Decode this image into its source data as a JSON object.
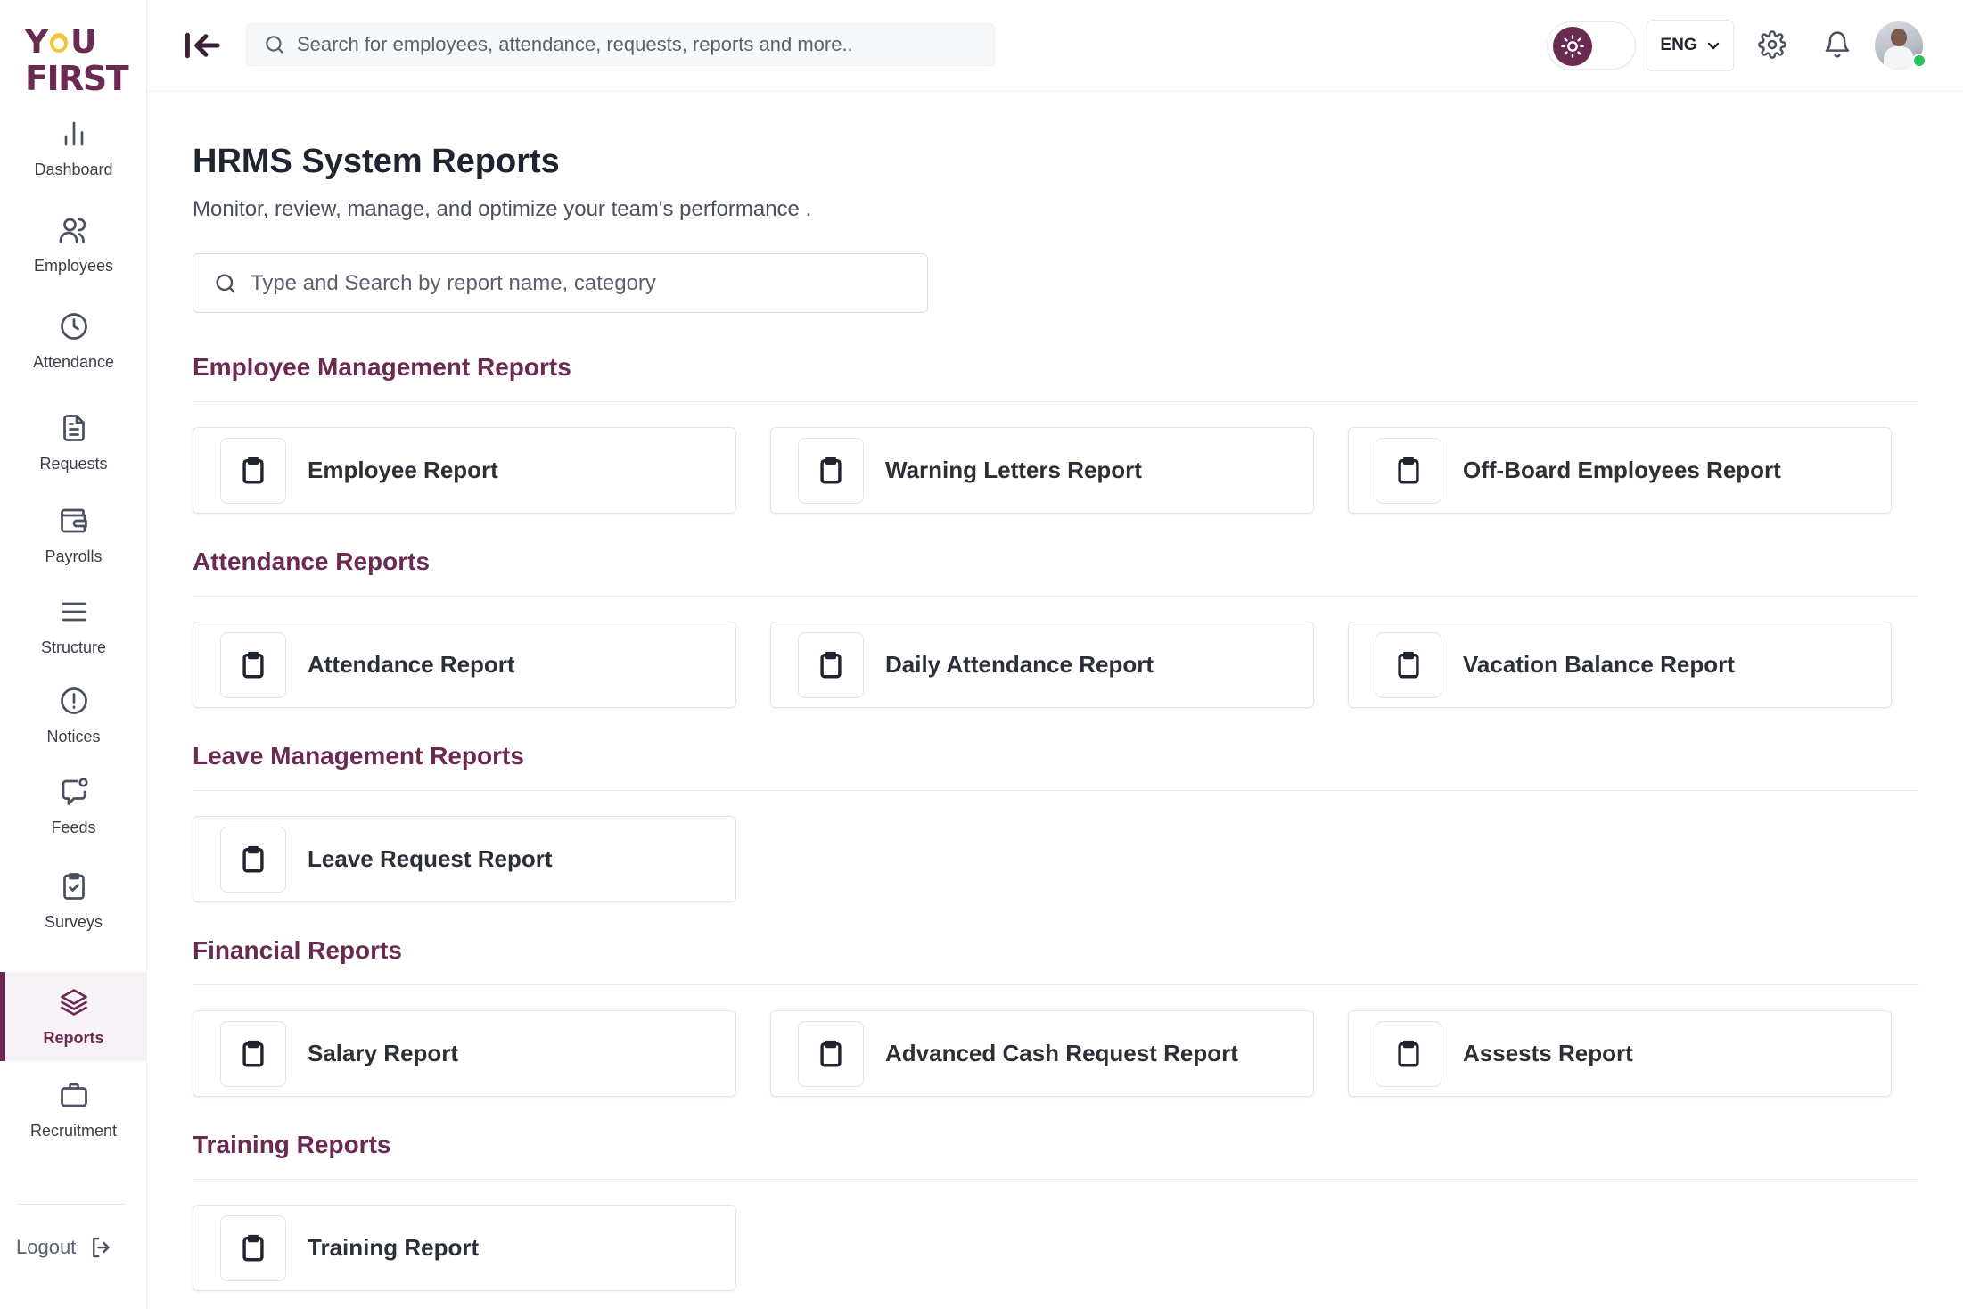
{
  "brand": {
    "logo_line1_a": "Y",
    "logo_line1_b": "U",
    "logo_line2": "FIRST",
    "accent_color": "#6b2a52",
    "logo_dot_color": "#f2c43a"
  },
  "sidebar": {
    "items": [
      {
        "label": "Dashboard",
        "icon": "bar-chart-icon"
      },
      {
        "label": "Employees",
        "icon": "users-icon"
      },
      {
        "label": "Attendance",
        "icon": "clock-icon"
      },
      {
        "label": "Requests",
        "icon": "document-icon"
      },
      {
        "label": "Payrolls",
        "icon": "wallet-icon"
      },
      {
        "label": "Structure",
        "icon": "menu-lines-icon"
      },
      {
        "label": "Notices",
        "icon": "alert-circle-icon"
      },
      {
        "label": "Feeds",
        "icon": "chat-icon"
      },
      {
        "label": "Surveys",
        "icon": "clipboard-check-icon"
      },
      {
        "label": "Reports",
        "icon": "layers-icon",
        "active": true
      },
      {
        "label": "Recruitment",
        "icon": "briefcase-icon"
      }
    ],
    "logout_label": "Logout"
  },
  "topbar": {
    "search_placeholder": "Search for employees, attendance, requests, reports and more..",
    "language": "ENG"
  },
  "main": {
    "title": "HRMS System Reports",
    "subtitle": "Monitor, review, manage, and optimize your team's performance .",
    "search_placeholder": "Type and Search by report name, category",
    "sections": [
      {
        "title": "Employee Management Reports",
        "reports": [
          "Employee Report",
          "Warning Letters Report",
          "Off-Board Employees Report"
        ]
      },
      {
        "title": "Attendance Reports",
        "reports": [
          "Attendance Report",
          "Daily Attendance Report",
          "Vacation Balance Report"
        ]
      },
      {
        "title": "Leave Management Reports",
        "reports": [
          "Leave Request Report"
        ]
      },
      {
        "title": "Financial Reports",
        "reports": [
          "Salary Report",
          "Advanced Cash Request Report",
          "Assests Report"
        ]
      },
      {
        "title": "Training Reports",
        "reports": [
          "Training Report"
        ]
      }
    ]
  }
}
